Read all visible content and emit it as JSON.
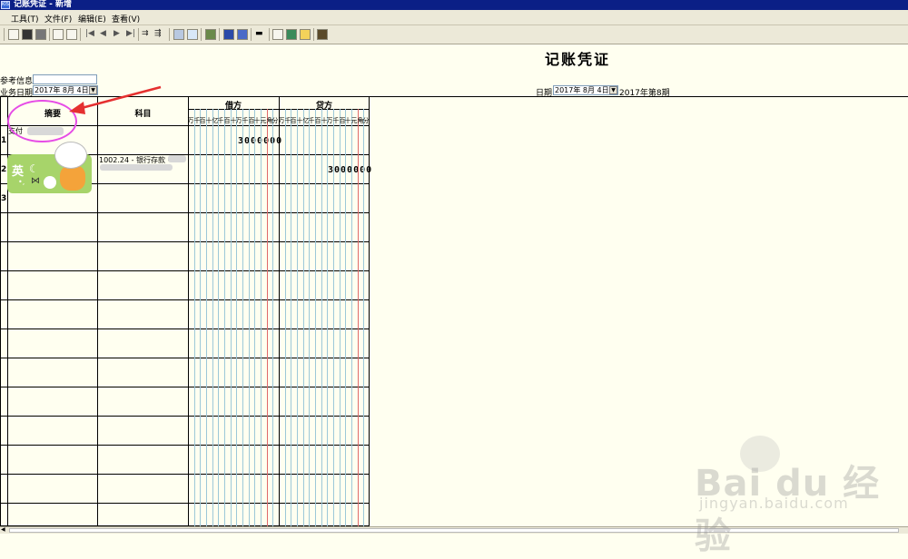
{
  "window": {
    "icon_text": "KIS",
    "title": "记账凭证 - 新增"
  },
  "menu": [
    {
      "label": "工具(T)"
    },
    {
      "label": "文件(F)"
    },
    {
      "label": "编辑(E)"
    },
    {
      "label": "查看(V)"
    }
  ],
  "toolbar_icons": [
    "new-icon",
    "save-icon",
    "save-as-icon",
    "preview-icon",
    "print-icon",
    "first-icon",
    "prev-icon",
    "next-icon",
    "last-icon",
    "insert-row-icon",
    "delete-row-icon",
    "calc-icon",
    "balance-icon",
    "audit-icon",
    "flag-icon",
    "card-icon",
    "cash-flow-icon",
    "copy-icon",
    "attach-icon",
    "mail-icon",
    "exit-icon"
  ],
  "voucher": {
    "title": "记账凭证",
    "ref_label": "参考信息:",
    "ref_value": "",
    "biz_date_label": "业务日期:",
    "biz_date_value": "2017年 8月 4日",
    "date_label": "日期:",
    "date_value": "2017年 8月 4日",
    "period": "2017年第8期"
  },
  "grid": {
    "col_summary": "摘要",
    "col_subject": "科目",
    "col_debit": "借方",
    "col_credit": "贷方",
    "units": [
      "万",
      "千",
      "百",
      "十",
      "亿",
      "千",
      "百",
      "十",
      "万",
      "千",
      "百",
      "十",
      "元",
      "角",
      "分"
    ],
    "rows": [
      {
        "num": "1",
        "summary": "支付",
        "subject": "",
        "debit": "3000000",
        "credit": ""
      },
      {
        "num": "2",
        "summary": "",
        "subject": "1002.24 - 银行存款 -",
        "debit": "",
        "credit": "3000000"
      },
      {
        "num": "3",
        "summary": "",
        "subject": "",
        "debit": "",
        "credit": ""
      }
    ]
  },
  "sticker": {
    "ying": "英"
  },
  "watermark": {
    "brand": "Bai du 经验",
    "url": "jingyan.baidu.com"
  }
}
